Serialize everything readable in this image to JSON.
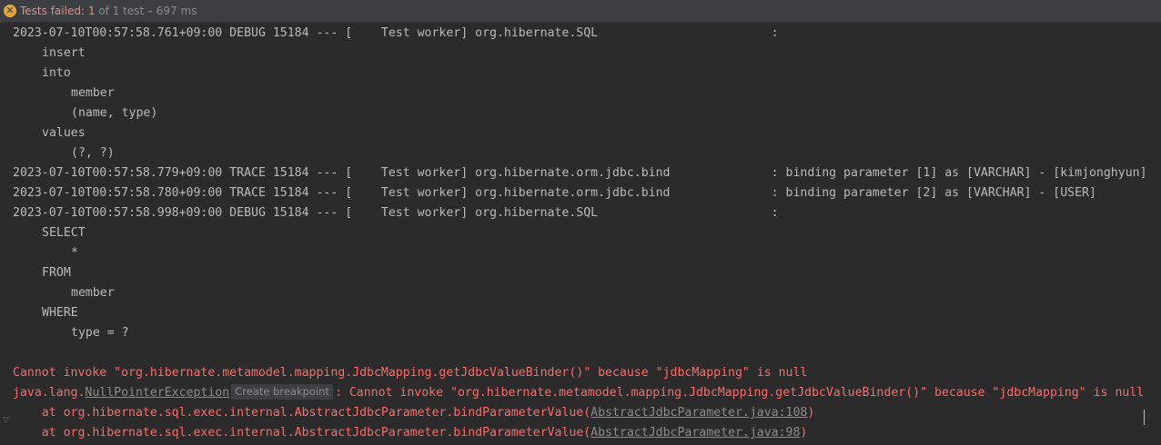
{
  "status": {
    "icon": "warning-x-icon",
    "label": "Tests failed: ",
    "count": "1",
    "of_total": " of 1 test",
    "separator": " – ",
    "duration": "697 ms"
  },
  "console": {
    "lines": [
      {
        "indent": 0,
        "text": "2023-07-10T00:57:58.761+09:00 DEBUG 15184 --- [    Test worker] org.hibernate.SQL                        :"
      },
      {
        "indent": 4,
        "text": "insert"
      },
      {
        "indent": 4,
        "text": "into"
      },
      {
        "indent": 8,
        "text": "member"
      },
      {
        "indent": 8,
        "text": "(name, type)"
      },
      {
        "indent": 4,
        "text": "values"
      },
      {
        "indent": 8,
        "text": "(?, ?)"
      },
      {
        "indent": 0,
        "text": "2023-07-10T00:57:58.779+09:00 TRACE 15184 --- [    Test worker] org.hibernate.orm.jdbc.bind              : binding parameter [1] as [VARCHAR] - [kimjonghyun]"
      },
      {
        "indent": 0,
        "text": "2023-07-10T00:57:58.780+09:00 TRACE 15184 --- [    Test worker] org.hibernate.orm.jdbc.bind              : binding parameter [2] as [VARCHAR] - [USER]"
      },
      {
        "indent": 0,
        "text": "2023-07-10T00:57:58.998+09:00 DEBUG 15184 --- [    Test worker] org.hibernate.SQL                        :"
      },
      {
        "indent": 4,
        "text": "SELECT"
      },
      {
        "indent": 8,
        "text": "*"
      },
      {
        "indent": 4,
        "text": "FROM"
      },
      {
        "indent": 8,
        "text": "member"
      },
      {
        "indent": 4,
        "text": "WHERE"
      },
      {
        "indent": 8,
        "text": "type = ?"
      },
      {
        "indent": 0,
        "text": ""
      }
    ],
    "error_message": "Cannot invoke \"org.hibernate.metamodel.mapping.JdbcMapping.getJdbcValueBinder()\" because \"jdbcMapping\" is null",
    "exception": {
      "package": "java.lang.",
      "class_link": "NullPointerException",
      "breakpoint_label": "Create breakpoint",
      "message": ": Cannot invoke \"org.hibernate.metamodel.mapping.JdbcMapping.getJdbcValueBinder()\" because \"jdbcMapping\" is null"
    },
    "stack": [
      {
        "prefix": "    at org.hibernate.sql.exec.internal.AbstractJdbcParameter.bindParameterValue(",
        "link": "AbstractJdbcParameter.java:108",
        "suffix": ")"
      },
      {
        "prefix": "    at org.hibernate.sql.exec.internal.AbstractJdbcParameter.bindParameterValue(",
        "link": "AbstractJdbcParameter.java:98",
        "suffix": ")"
      }
    ]
  },
  "colors": {
    "background": "#2b2b2b",
    "text": "#bbbbbb",
    "error": "#ff6b68",
    "status_fail": "#e08c8c",
    "status_icon": "#e2a53a"
  }
}
